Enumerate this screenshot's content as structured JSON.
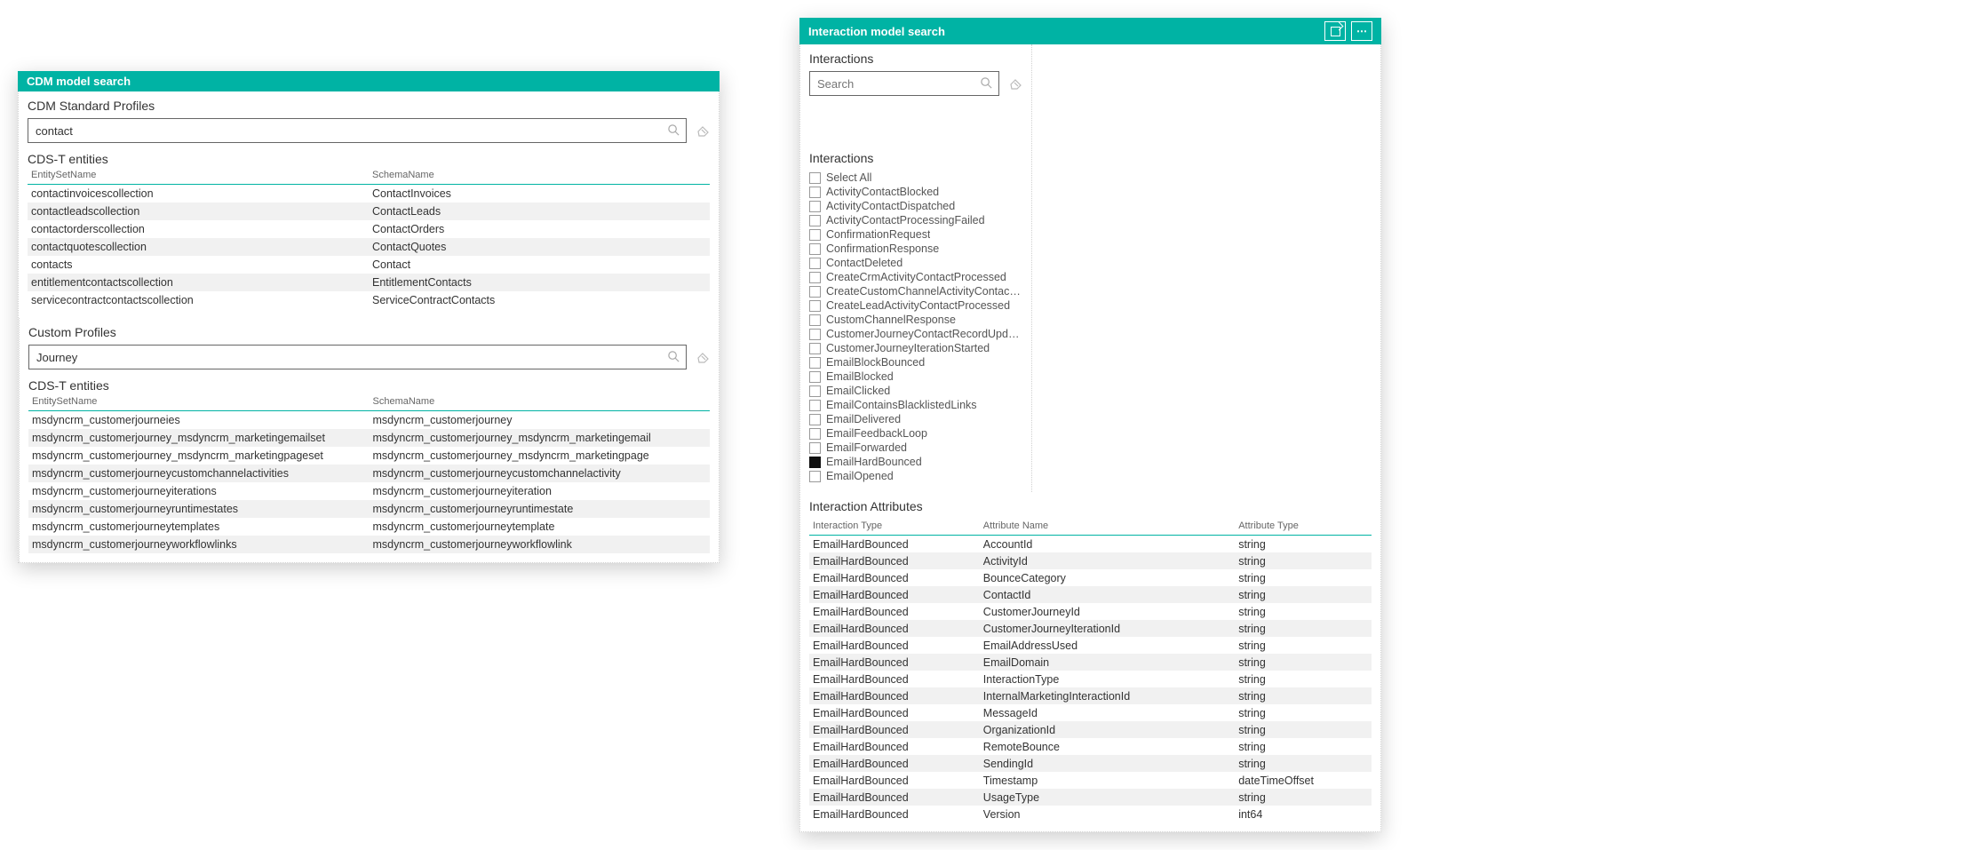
{
  "left": {
    "title": "CDM model search",
    "cdm": {
      "section": "CDM Standard Profiles",
      "search_value": "contact",
      "sub": "CDS-T entities",
      "cols": [
        "EntitySetName",
        "SchemaName"
      ],
      "rows": [
        [
          "contactinvoicescollection",
          "ContactInvoices"
        ],
        [
          "contactleadscollection",
          "ContactLeads"
        ],
        [
          "contactorderscollection",
          "ContactOrders"
        ],
        [
          "contactquotescollection",
          "ContactQuotes"
        ],
        [
          "contacts",
          "Contact"
        ],
        [
          "entitlementcontactscollection",
          "EntitlementContacts"
        ],
        [
          "servicecontractcontactscollection",
          "ServiceContractContacts"
        ]
      ]
    },
    "custom": {
      "section": "Custom Profiles",
      "search_value": "Journey",
      "sub": "CDS-T entities",
      "cols": [
        "EntitySetName",
        "SchemaName"
      ],
      "rows": [
        [
          "msdyncrm_customerjourneies",
          "msdyncrm_customerjourney"
        ],
        [
          "msdyncrm_customerjourney_msdyncrm_marketingemailset",
          "msdyncrm_customerjourney_msdyncrm_marketingemail"
        ],
        [
          "msdyncrm_customerjourney_msdyncrm_marketingpageset",
          "msdyncrm_customerjourney_msdyncrm_marketingpage"
        ],
        [
          "msdyncrm_customerjourneycustomchannelactivities",
          "msdyncrm_customerjourneycustomchannelactivity"
        ],
        [
          "msdyncrm_customerjourneyiterations",
          "msdyncrm_customerjourneyiteration"
        ],
        [
          "msdyncrm_customerjourneyruntimestates",
          "msdyncrm_customerjourneyruntimestate"
        ],
        [
          "msdyncrm_customerjourneytemplates",
          "msdyncrm_customerjourneytemplate"
        ],
        [
          "msdyncrm_customerjourneyworkflowlinks",
          "msdyncrm_customerjourneyworkflowlink"
        ]
      ]
    }
  },
  "right": {
    "title": "Interaction model search",
    "interactions_section": "Interactions",
    "search_placeholder": "Search",
    "interactions_list_heading": "Interactions",
    "interactions": [
      {
        "label": "Select All",
        "checked": false
      },
      {
        "label": "ActivityContactBlocked",
        "checked": false
      },
      {
        "label": "ActivityContactDispatched",
        "checked": false
      },
      {
        "label": "ActivityContactProcessingFailed",
        "checked": false
      },
      {
        "label": "ConfirmationRequest",
        "checked": false
      },
      {
        "label": "ConfirmationResponse",
        "checked": false
      },
      {
        "label": "ContactDeleted",
        "checked": false
      },
      {
        "label": "CreateCrmActivityContactProcessed",
        "checked": false
      },
      {
        "label": "CreateCustomChannelActivityContactProc...",
        "checked": false
      },
      {
        "label": "CreateLeadActivityContactProcessed",
        "checked": false
      },
      {
        "label": "CustomChannelResponse",
        "checked": false
      },
      {
        "label": "CustomerJourneyContactRecordUpdated",
        "checked": false
      },
      {
        "label": "CustomerJourneyIterationStarted",
        "checked": false
      },
      {
        "label": "EmailBlockBounced",
        "checked": false
      },
      {
        "label": "EmailBlocked",
        "checked": false
      },
      {
        "label": "EmailClicked",
        "checked": false
      },
      {
        "label": "EmailContainsBlacklistedLinks",
        "checked": false
      },
      {
        "label": "EmailDelivered",
        "checked": false
      },
      {
        "label": "EmailFeedbackLoop",
        "checked": false
      },
      {
        "label": "EmailForwarded",
        "checked": false
      },
      {
        "label": "EmailHardBounced",
        "checked": true
      },
      {
        "label": "EmailOpened",
        "checked": false
      }
    ],
    "attr_section": "Interaction Attributes",
    "attr_cols": [
      "Interaction Type",
      "Attribute Name",
      "Attribute Type"
    ],
    "attr_rows": [
      [
        "EmailHardBounced",
        "AccountId",
        "string"
      ],
      [
        "EmailHardBounced",
        "ActivityId",
        "string"
      ],
      [
        "EmailHardBounced",
        "BounceCategory",
        "string"
      ],
      [
        "EmailHardBounced",
        "ContactId",
        "string"
      ],
      [
        "EmailHardBounced",
        "CustomerJourneyId",
        "string"
      ],
      [
        "EmailHardBounced",
        "CustomerJourneyIterationId",
        "string"
      ],
      [
        "EmailHardBounced",
        "EmailAddressUsed",
        "string"
      ],
      [
        "EmailHardBounced",
        "EmailDomain",
        "string"
      ],
      [
        "EmailHardBounced",
        "InteractionType",
        "string"
      ],
      [
        "EmailHardBounced",
        "InternalMarketingInteractionId",
        "string"
      ],
      [
        "EmailHardBounced",
        "MessageId",
        "string"
      ],
      [
        "EmailHardBounced",
        "OrganizationId",
        "string"
      ],
      [
        "EmailHardBounced",
        "RemoteBounce",
        "string"
      ],
      [
        "EmailHardBounced",
        "SendingId",
        "string"
      ],
      [
        "EmailHardBounced",
        "Timestamp",
        "dateTimeOffset"
      ],
      [
        "EmailHardBounced",
        "UsageType",
        "string"
      ],
      [
        "EmailHardBounced",
        "Version",
        "int64"
      ]
    ]
  }
}
